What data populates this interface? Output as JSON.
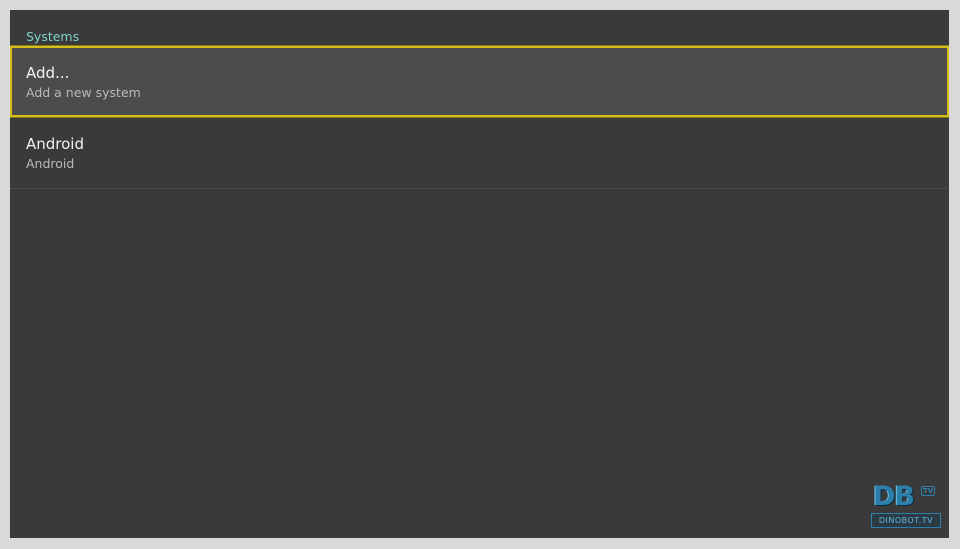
{
  "section": {
    "title": "Systems"
  },
  "items": [
    {
      "title": "Add...",
      "summary": "Add a new system"
    },
    {
      "title": "Android",
      "summary": "Android"
    }
  ],
  "watermark": {
    "letters": "DB",
    "badge": "TV",
    "domain": "DINOBOT.TV"
  },
  "colors": {
    "header_accent": "#7ed3c8",
    "selection_border": "#d6be1a",
    "background": "#3a3a3a"
  }
}
